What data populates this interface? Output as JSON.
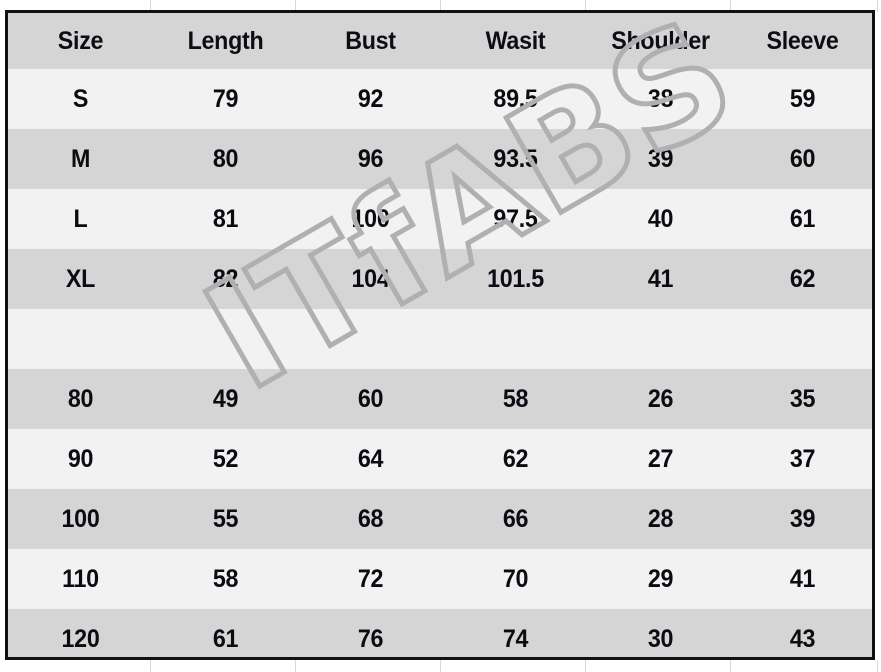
{
  "table": {
    "headers": [
      "Size",
      "Length",
      "Bust",
      "Wasit",
      "Shoulder",
      "Sleeve"
    ],
    "rows": [
      {
        "cells": [
          "S",
          "79",
          "92",
          "89.5",
          "38",
          "59"
        ]
      },
      {
        "cells": [
          "M",
          "80",
          "96",
          "93.5",
          "39",
          "60"
        ]
      },
      {
        "cells": [
          "L",
          "81",
          "100",
          "97.5",
          "40",
          "61"
        ]
      },
      {
        "cells": [
          "XL",
          "82",
          "104",
          "101.5",
          "41",
          "62"
        ]
      },
      {
        "cells": [
          "",
          "",
          "",
          "",
          "",
          ""
        ]
      },
      {
        "cells": [
          "80",
          "49",
          "60",
          "58",
          "26",
          "35"
        ]
      },
      {
        "cells": [
          "90",
          "52",
          "64",
          "62",
          "27",
          "37"
        ]
      },
      {
        "cells": [
          "100",
          "55",
          "68",
          "66",
          "28",
          "39"
        ]
      },
      {
        "cells": [
          "110",
          "58",
          "72",
          "70",
          "29",
          "41"
        ]
      },
      {
        "cells": [
          "120",
          "61",
          "76",
          "74",
          "30",
          "43"
        ]
      }
    ]
  },
  "watermark": {
    "text": "ITfABS"
  },
  "colors": {
    "row_light": "#f2f2f2",
    "row_dark": "#d5d5d5",
    "header_bg": "#d5d5d5",
    "text": "#0b0b12",
    "border": "#111111",
    "watermark_stroke": "#b0b0b0",
    "page_bg": "#ffffff",
    "guide_line": "#d8d8d8"
  }
}
